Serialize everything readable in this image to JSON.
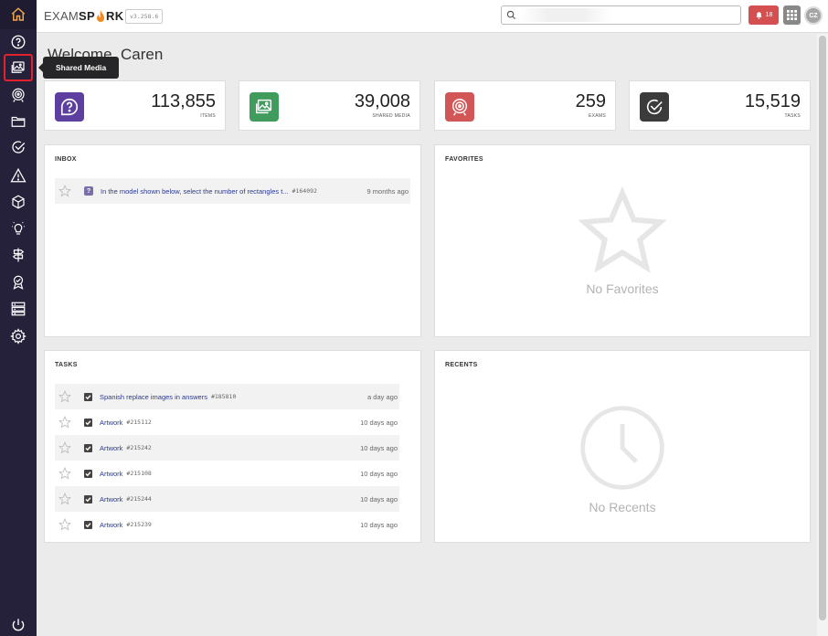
{
  "header": {
    "logo_left": "EXAM",
    "logo_mid": "SP",
    "logo_right": "RK",
    "version": "v3.258.6",
    "search_value": "",
    "notification_count": "18",
    "user_initials": "CZ"
  },
  "sidebar": {
    "tooltip": "Shared Media",
    "items": [
      {
        "name": "home-icon"
      },
      {
        "name": "question-icon"
      },
      {
        "name": "shared-media-icon"
      },
      {
        "name": "target-icon"
      },
      {
        "name": "folder-icon"
      },
      {
        "name": "check-circle-icon"
      },
      {
        "name": "warning-icon"
      },
      {
        "name": "cube-icon"
      },
      {
        "name": "lightbulb-icon"
      },
      {
        "name": "signpost-icon"
      },
      {
        "name": "award-icon"
      },
      {
        "name": "server-icon"
      },
      {
        "name": "settings-icon"
      },
      {
        "name": "power-icon"
      }
    ]
  },
  "welcome": "Welcome, Caren",
  "stats": [
    {
      "value": "113,855",
      "label": "ITEMS",
      "color": "#5c3f9e",
      "icon": "question-bubble-icon"
    },
    {
      "value": "39,008",
      "label": "SHARED MEDIA",
      "color": "#3f9c5c",
      "icon": "image-icon"
    },
    {
      "value": "259",
      "label": "EXAMS",
      "color": "#d15656",
      "icon": "target-icon"
    },
    {
      "value": "15,519",
      "label": "TASKS",
      "color": "#3b3b3b",
      "icon": "check-circle-icon"
    }
  ],
  "inbox": {
    "title": "INBOX",
    "rows": [
      {
        "title": "In the model shown below, select the number of rectangles t...",
        "id": "#164092",
        "age": "9 months ago"
      }
    ]
  },
  "favorites": {
    "title": "FAVORITES",
    "empty": "No Favorites"
  },
  "tasks": {
    "title": "TASKS",
    "rows": [
      {
        "title": "Spanish replace images in answers",
        "id": "#185810",
        "age": "a day ago"
      },
      {
        "title": "Artwork",
        "id": "#215112",
        "age": "10 days ago"
      },
      {
        "title": "Artwork",
        "id": "#215242",
        "age": "10 days ago"
      },
      {
        "title": "Artwork",
        "id": "#215108",
        "age": "10 days ago"
      },
      {
        "title": "Artwork",
        "id": "#215244",
        "age": "10 days ago"
      },
      {
        "title": "Artwork",
        "id": "#215239",
        "age": "10 days ago"
      }
    ]
  },
  "recents": {
    "title": "RECENTS",
    "empty": "No Recents"
  }
}
